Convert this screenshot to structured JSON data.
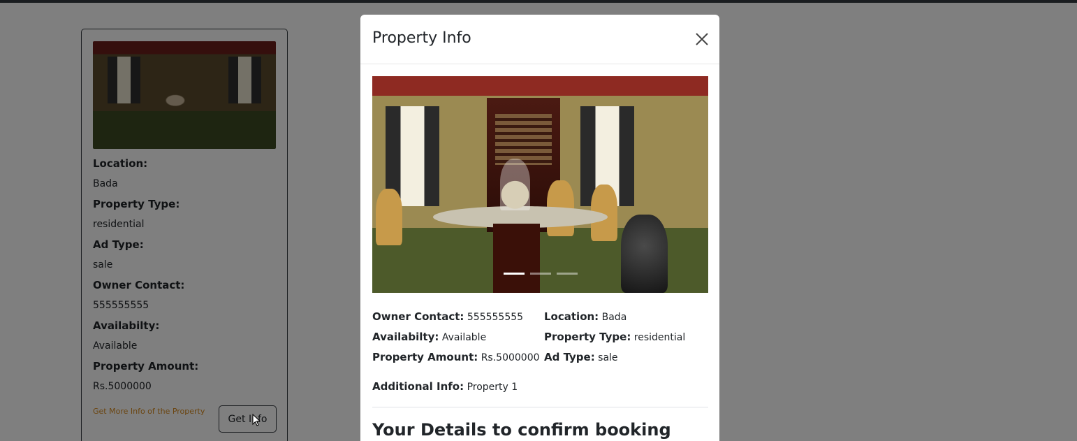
{
  "card": {
    "fields": [
      {
        "label": "Location:",
        "value": "Bada"
      },
      {
        "label": "Property Type:",
        "value": "residential"
      },
      {
        "label": "Ad Type:",
        "value": "sale"
      },
      {
        "label": "Owner Contact:",
        "value": "555555555"
      },
      {
        "label": "Availabilty:",
        "value": "Available"
      },
      {
        "label": "Property Amount:",
        "value": "Rs.5000000"
      }
    ],
    "more_info_link": "Get More Info of the Property",
    "get_info_button": "Get Info"
  },
  "modal": {
    "title": "Property Info",
    "carousel": {
      "slide_count": 3,
      "active_index": 0
    },
    "details": {
      "owner_contact": {
        "label": "Owner Contact:",
        "value": "555555555"
      },
      "location": {
        "label": "Location:",
        "value": "Bada"
      },
      "availability": {
        "label": "Availabilty:",
        "value": "Available"
      },
      "property_type": {
        "label": "Property Type:",
        "value": "residential"
      },
      "property_amount": {
        "label": "Property Amount:",
        "value": "Rs.5000000"
      },
      "ad_type": {
        "label": "Ad Type:",
        "value": "sale"
      },
      "additional_info": {
        "label": "Additional Info:",
        "value": "Property 1"
      }
    },
    "booking_heading": "Your Details to confirm booking"
  },
  "icons": {
    "close": "close-icon",
    "cursor": "mouse-pointer-icon"
  },
  "colors": {
    "link": "#d68a1f",
    "backdrop": "rgba(0,0,0,0.5)",
    "text": "#212529"
  }
}
